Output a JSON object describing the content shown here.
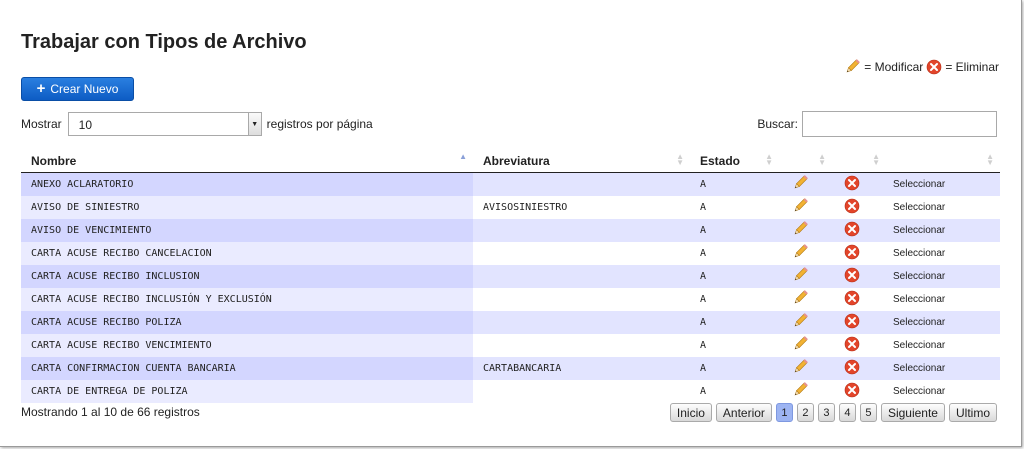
{
  "title": "Trabajar con Tipos de Archivo",
  "legend": {
    "modify_text": "= Modificar",
    "delete_text": "= Eliminar"
  },
  "new_button": {
    "label": "Crear Nuevo"
  },
  "length": {
    "before": "Mostrar",
    "value": "10",
    "after": "registros por página"
  },
  "search": {
    "label": "Buscar:",
    "value": ""
  },
  "table": {
    "headers": [
      "Nombre",
      "Abreviatura",
      "Estado",
      "",
      "",
      ""
    ],
    "rows": [
      {
        "nombre": "ANEXO ACLARATORIO",
        "abreviatura": "",
        "estado": "A",
        "action": "Seleccionar"
      },
      {
        "nombre": "AVISO DE SINIESTRO",
        "abreviatura": "AVISOSINIESTRO",
        "estado": "A",
        "action": "Seleccionar"
      },
      {
        "nombre": "AVISO DE VENCIMIENTO",
        "abreviatura": "",
        "estado": "A",
        "action": "Seleccionar"
      },
      {
        "nombre": "CARTA ACUSE RECIBO CANCELACION",
        "abreviatura": "",
        "estado": "A",
        "action": "Seleccionar"
      },
      {
        "nombre": "CARTA ACUSE RECIBO INCLUSION",
        "abreviatura": "",
        "estado": "A",
        "action": "Seleccionar"
      },
      {
        "nombre": "CARTA ACUSE RECIBO INCLUSIÓN Y EXCLUSIÓN",
        "abreviatura": "",
        "estado": "A",
        "action": "Seleccionar"
      },
      {
        "nombre": "CARTA ACUSE RECIBO POLIZA",
        "abreviatura": "",
        "estado": "A",
        "action": "Seleccionar"
      },
      {
        "nombre": "CARTA ACUSE RECIBO VENCIMIENTO",
        "abreviatura": "",
        "estado": "A",
        "action": "Seleccionar"
      },
      {
        "nombre": "CARTA CONFIRMACION CUENTA BANCARIA",
        "abreviatura": "CARTABANCARIA",
        "estado": "A",
        "action": "Seleccionar"
      },
      {
        "nombre": "CARTA DE ENTREGA DE POLIZA",
        "abreviatura": "",
        "estado": "A",
        "action": "Seleccionar"
      }
    ]
  },
  "info": "Mostrando 1 al 10 de 66 registros",
  "pager": {
    "first": "Inicio",
    "prev": "Anterior",
    "pages": [
      "1",
      "2",
      "3",
      "4",
      "5"
    ],
    "current": "1",
    "next": "Siguiente",
    "last": "Ultimo"
  },
  "icons": {
    "modify": "pencil-icon",
    "delete": "delete-icon"
  },
  "colors": {
    "primary_button": "#0d5cc4",
    "row_odd": "#e2e4ff",
    "row_sorted": "#d3d6ff",
    "delete_icon": "#e2452a",
    "current_page": "#9db4f2"
  }
}
